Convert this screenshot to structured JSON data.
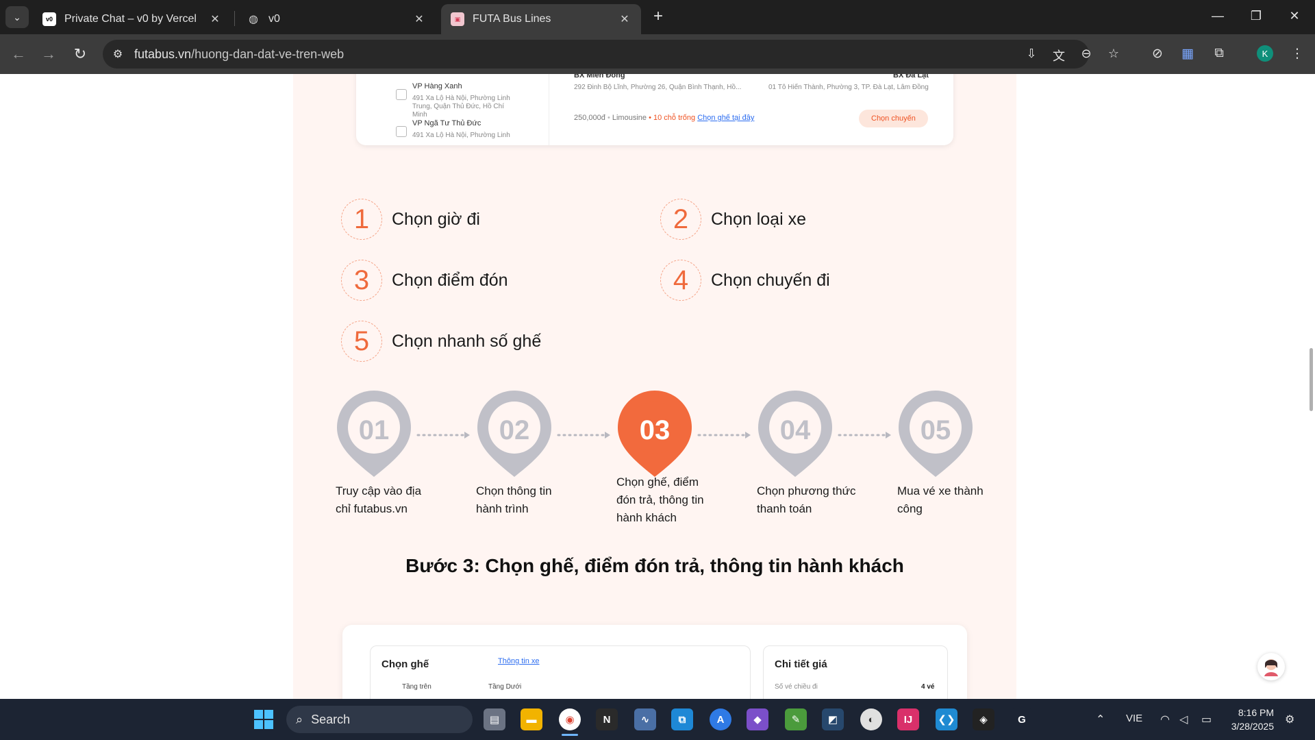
{
  "browser": {
    "tabs": [
      {
        "title": "Private Chat – v0 by Vercel",
        "favicon": "v0-logo",
        "active": false
      },
      {
        "title": "v0",
        "favicon": "globe-icon",
        "active": false
      },
      {
        "title": "FUTA Bus Lines",
        "favicon": "futa-logo",
        "active": true
      }
    ],
    "url_domain": "futabus.vn",
    "url_path": "/huong-dan-dat-ve-tren-web",
    "profile_initial": "K"
  },
  "top_card": {
    "offices": [
      {
        "name": "VP Hàng Xanh",
        "address": "491 Xa Lộ Hà Nội, Phường Linh Trung, Quận Thủ Đức, Hồ Chí Minh"
      },
      {
        "name": "VP Ngã Tư Thủ Đức",
        "address": "491 Xa Lộ Hà Nội, Phường Linh"
      }
    ],
    "origin": {
      "name": "BX Miền Đông",
      "address": "292 Đinh Bộ Lĩnh, Phường 26, Quận Bình Thạnh, Hồ..."
    },
    "destination": {
      "name": "BX Đà Lạt",
      "address": "01 Tô Hiến Thành, Phường 3, TP. Đà Lạt, Lâm Đồng"
    },
    "price": "250,000đ",
    "vehicle": "Limousine",
    "seats_left": "10 chỗ trống",
    "choose_seat_link": "Chọn ghế tại đây",
    "choose_trip_button": "Chọn chuyến"
  },
  "steps": [
    {
      "num": "1",
      "label": "Chọn giờ đi"
    },
    {
      "num": "2",
      "label": "Chọn loại xe"
    },
    {
      "num": "3",
      "label": "Chọn điểm đón"
    },
    {
      "num": "4",
      "label": "Chọn chuyến đi"
    },
    {
      "num": "5",
      "label": "Chọn nhanh số ghế"
    }
  ],
  "pins": [
    {
      "num": "01",
      "caption_lines": [
        "Truy cập vào địa",
        "chỉ futabus.vn"
      ],
      "active": false
    },
    {
      "num": "02",
      "caption_lines": [
        "Chọn thông tin",
        "hành trình"
      ],
      "active": false
    },
    {
      "num": "03",
      "caption_lines": [
        "Chọn ghế, điểm",
        "đón trả, thông tin",
        "hành khách"
      ],
      "active": true
    },
    {
      "num": "04",
      "caption_lines": [
        "Chọn phương thức",
        "thanh toán"
      ],
      "active": false
    },
    {
      "num": "05",
      "caption_lines": [
        "Mua vé xe thành",
        "công"
      ],
      "active": false
    }
  ],
  "section_heading": "Bước 3: Chọn ghế, điểm đón trả, thông tin hành khách",
  "bottom_card": {
    "seat_title": "Chọn ghế",
    "vehicle_info_link": "Thông tin xe",
    "upper_deck": "Tầng trên",
    "lower_deck": "Tầng Dưới",
    "price_detail_title": "Chi tiết giá",
    "tickets_label": "Số vé chiều đi",
    "tickets_value": "4 vé"
  },
  "taskbar": {
    "search_label": "Search",
    "language": "VIE",
    "time": "8:16 PM",
    "date": "3/28/2025"
  },
  "colors": {
    "accent": "#ef5222",
    "pin_inactive": "#c0c0c8",
    "pin_active": "#f26a3d",
    "page_bg": "#fff5f2"
  }
}
